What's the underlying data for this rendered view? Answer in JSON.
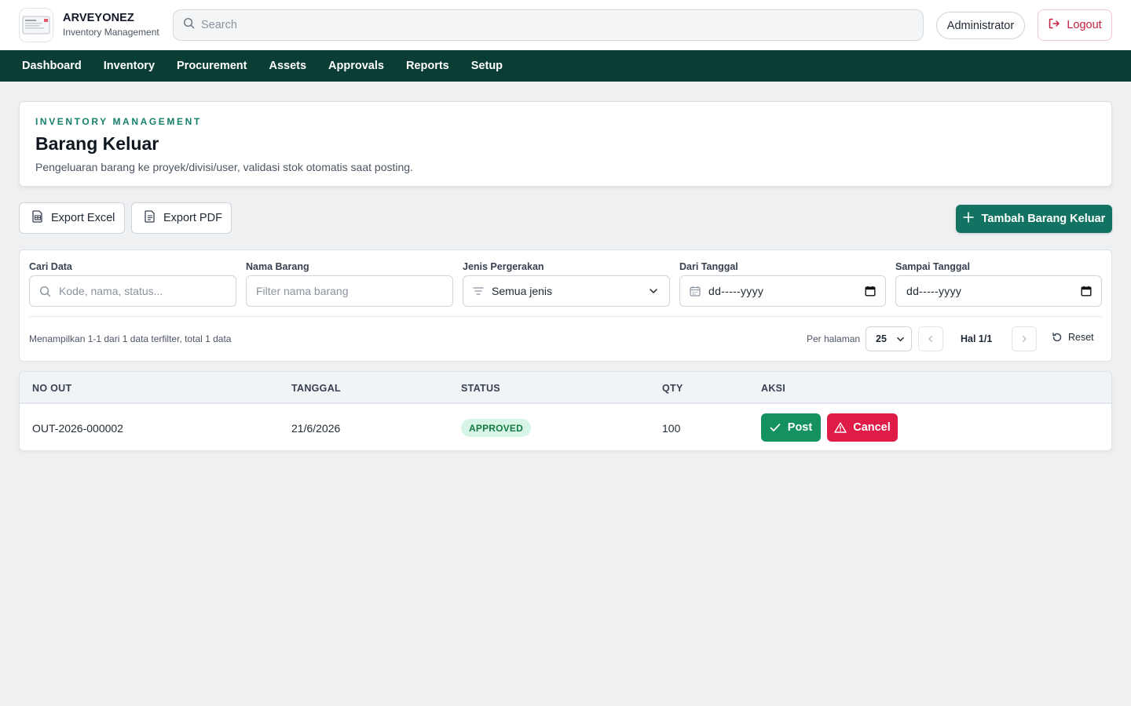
{
  "header": {
    "brand_name": "ARVEYONEZ",
    "brand_sub": "Inventory Management",
    "search_placeholder": "Search",
    "user_label": "Administrator",
    "logout_label": "Logout"
  },
  "nav": {
    "items": [
      "Dashboard",
      "Inventory",
      "Procurement",
      "Assets",
      "Approvals",
      "Reports",
      "Setup"
    ]
  },
  "page": {
    "eyebrow": "INVENTORY MANAGEMENT",
    "title": "Barang Keluar",
    "description": "Pengeluaran barang ke proyek/divisi/user, validasi stok otomatis saat posting."
  },
  "actions": {
    "export_excel": "Export Excel",
    "export_pdf": "Export PDF",
    "add_label": "Tambah Barang Keluar"
  },
  "filters": {
    "search_label": "Cari Data",
    "search_placeholder": "Kode, nama, status...",
    "item_label": "Nama Barang",
    "item_placeholder": "Filter nama barang",
    "movement_label": "Jenis Pergerakan",
    "movement_value": "Semua jenis",
    "from_label": "Dari Tanggal",
    "from_value": "dd-----yyyy",
    "to_label": "Sampai Tanggal",
    "to_value": "dd-----yyyy",
    "summary": "Menampilkan 1-1 dari 1 data terfilter, total 1 data",
    "per_page_label": "Per halaman",
    "per_page_value": "25",
    "page_info": "Hal 1/1",
    "reset_label": "Reset"
  },
  "table": {
    "columns": [
      "NO OUT",
      "TANGGAL",
      "STATUS",
      "QTY",
      "AKSI"
    ],
    "rows": [
      {
        "no_out": "OUT-2026-000002",
        "tanggal": "21/6/2026",
        "status": "APPROVED",
        "qty": "100",
        "post_label": "Post",
        "cancel_label": "Cancel"
      }
    ]
  },
  "colors": {
    "nav_bg": "#0a3d34",
    "primary": "#137363",
    "post": "#13925f",
    "cancel": "#df1b48",
    "status_approved_bg": "#d7f5e6",
    "status_approved_text": "#137a43"
  },
  "icons": {
    "logo": "app-logo-icon",
    "search": "search-icon",
    "logout": "logout-icon",
    "excel": "spreadsheet-file-icon",
    "pdf": "document-file-icon",
    "add": "plus-icon",
    "filter": "filter-icon",
    "calendar": "calendar-icon",
    "chevron": "chevron-down-icon",
    "prev": "chevron-left-icon",
    "next": "chevron-right-icon",
    "reset": "reset-icon",
    "check": "check-icon",
    "warning": "warning-icon"
  }
}
